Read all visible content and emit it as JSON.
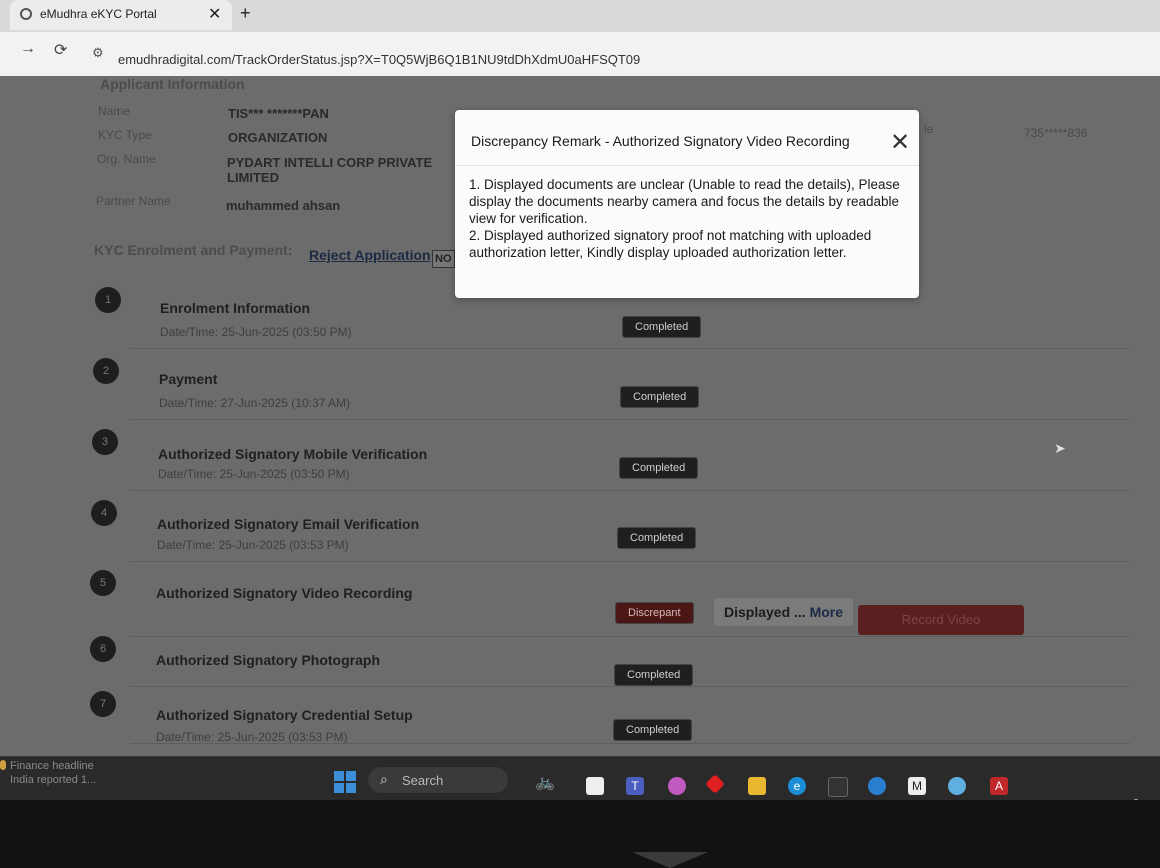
{
  "browser": {
    "tab_title": "eMudhra eKYC Portal",
    "url": "emudhradigital.com/TrackOrderStatus.jsp?X=T0Q5WjB6Q1B1NU9tdDhXdmU0aHFSQT09"
  },
  "applicant": {
    "heading": "Applicant Information",
    "fields": [
      {
        "label": "Name",
        "value": "TIS*** *******PAN"
      },
      {
        "label": "KYC Type",
        "value": "ORGANIZATION"
      },
      {
        "label": "Org. Name",
        "value": "PYDART INTELLI CORP PRIVATE LIMITED"
      },
      {
        "label": "Partner Name",
        "value": "muhammed ahsan"
      }
    ],
    "right_partial_label": "le",
    "right_partial_value": "735*****836"
  },
  "enrolment": {
    "title": "KYC Enrolment and Payment:",
    "reject_link": "Reject Application",
    "partial_box": "NO"
  },
  "steps": [
    {
      "num": "1",
      "title": "Enrolment Information",
      "date": "Date/Time: 25-Jun-2025 (03:50 PM)",
      "status": "Completed"
    },
    {
      "num": "2",
      "title": "Payment",
      "date": "Date/Time: 27-Jun-2025 (10:37 AM)",
      "status": "Completed"
    },
    {
      "num": "3",
      "title": "Authorized Signatory Mobile Verification",
      "date": "Date/Time: 25-Jun-2025 (03:50 PM)",
      "status": "Completed"
    },
    {
      "num": "4",
      "title": "Authorized Signatory Email Verification",
      "date": "Date/Time: 25-Jun-2025 (03:53 PM)",
      "status": "Completed"
    },
    {
      "num": "5",
      "title": "Authorized Signatory Video Recording",
      "date": "",
      "status": "Discrepant",
      "remark_short": "Displayed ...",
      "remark_more": "More",
      "action": "Record Video"
    },
    {
      "num": "6",
      "title": "Authorized Signatory Photograph",
      "date": "",
      "status": "Completed"
    },
    {
      "num": "7",
      "title": "Authorized Signatory Credential Setup",
      "date": "Date/Time: 25-Jun-2025 (03:53 PM)",
      "status": "Completed"
    }
  ],
  "modal": {
    "title": "Discrepancy Remark - Authorized Signatory Video Recording",
    "lines": [
      "1. Displayed documents are unclear (Unable to read the details), Please display the documents nearby camera and focus the details by readable view for verification.",
      "2. Displayed authorized signatory proof not matching with uploaded authorization letter, Kindly display uploaded authorization letter."
    ]
  },
  "taskbar": {
    "news_title": "Finance headline",
    "news_sub": "India reported 1...",
    "search_label": "Search"
  },
  "colors": {
    "accent_link": "#1d2a44",
    "discrepant": "#4b1616",
    "record_button": "#5a2020"
  }
}
